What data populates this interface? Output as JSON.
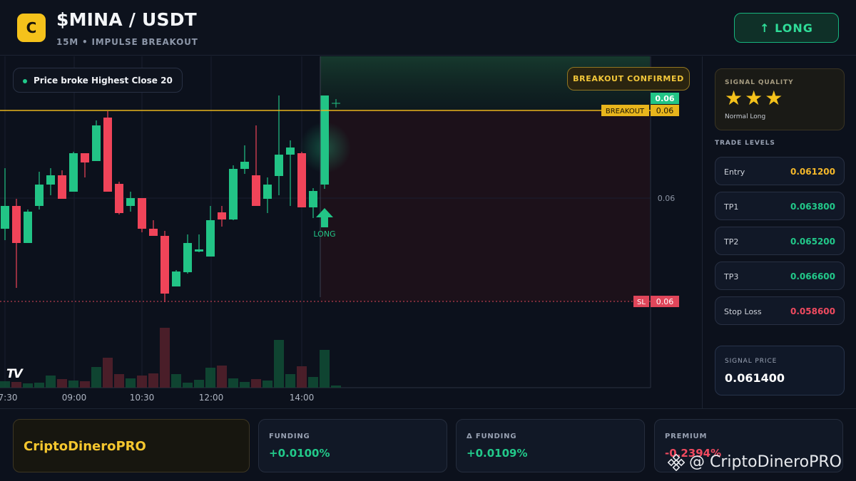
{
  "header": {
    "logo_letter": "C",
    "pair": "$MINA / USDT",
    "subtitle": "15M • IMPULSE BREAKOUT",
    "action_label": "↑ LONG"
  },
  "chart": {
    "note": "Price broke Highest Close 20",
    "confirm_badge": "BREAKOUT CONFIRMED",
    "watermark_logo": "TV",
    "time_labels": [
      "7:30",
      "09:00",
      "10:30",
      "12:00",
      "14:00"
    ],
    "price_tick": "0.06",
    "current_price_label": "0.06",
    "breakout_label": "BREAKOUT",
    "breakout_price": "0.06",
    "sl_label": "SL",
    "sl_price": "0.06",
    "signal_marker": "LONG",
    "colors": {
      "up": "#22c486",
      "down": "#f04459",
      "breakout": "#e8b51c"
    }
  },
  "sidebar": {
    "quality_label": "SIGNAL QUALITY",
    "stars": "★★★",
    "quality_desc": "Normal Long",
    "levels_title": "TRADE LEVELS",
    "levels": [
      {
        "name": "Entry",
        "value": "0.061200",
        "color": "#f5b82a"
      },
      {
        "name": "TP1",
        "value": "0.063800",
        "color": "#22c98a"
      },
      {
        "name": "TP2",
        "value": "0.065200",
        "color": "#22c98a"
      },
      {
        "name": "TP3",
        "value": "0.066600",
        "color": "#22c98a"
      },
      {
        "name": "Stop Loss",
        "value": "0.058600",
        "color": "#f04a5f"
      }
    ],
    "signal_price_label": "SIGNAL PRICE",
    "signal_price": "0.061400"
  },
  "footer": {
    "brand": "CriptoDineroPRO",
    "stats": [
      {
        "label": "FUNDING",
        "value": "+0.0100%",
        "color": "#22c98a"
      },
      {
        "label": "Δ FUNDING",
        "value": "+0.0109%",
        "color": "#22c98a"
      },
      {
        "label": "PREMIUM",
        "value": "-0.2394%",
        "color": "#f04a5f"
      }
    ],
    "watermark": "@ CriptoDineroPRO"
  }
}
